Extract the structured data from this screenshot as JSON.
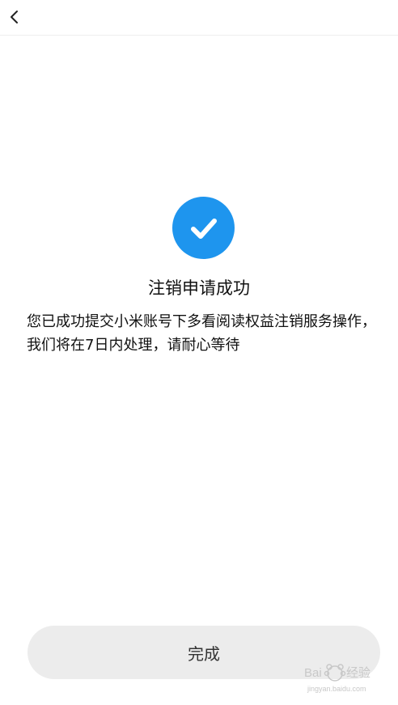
{
  "header": {
    "back_icon": "chevron-left-icon"
  },
  "result": {
    "icon": "check-circle-icon",
    "accent_color": "#1e95ee",
    "title": "注销申请成功",
    "description": "您已成功提交小米账号下多看阅读权益注销服务操作，我们将在7日内处理，请耐心等待"
  },
  "footer": {
    "done_label": "完成"
  },
  "watermark": {
    "brand": "Baidu 经验",
    "url": "jingyan.baidu.com"
  }
}
